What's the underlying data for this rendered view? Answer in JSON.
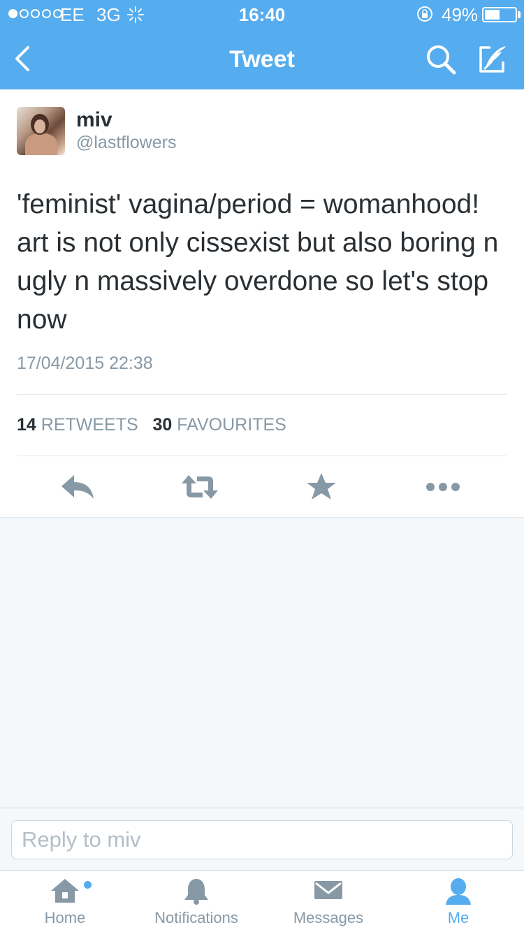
{
  "status_bar": {
    "carrier": "EE",
    "network": "3G",
    "time": "16:40",
    "battery_percent": "49%",
    "battery_level": 0.49,
    "signal_bars_filled": 1,
    "signal_bars_total": 5
  },
  "nav": {
    "title": "Tweet",
    "back_icon": "chevron-left-icon",
    "search_icon": "search-icon",
    "compose_icon": "compose-icon"
  },
  "tweet": {
    "display_name": "miv",
    "handle": "@lastflowers",
    "text": "'feminist' vagina/period = womanhood! art is not only cissexist but also boring n ugly n massively overdone so let's stop now",
    "timestamp": "17/04/2015 22:38",
    "retweets_count": "14",
    "retweets_label": "RETWEETS",
    "favourites_count": "30",
    "favourites_label": "FAVOURITES",
    "actions": [
      "reply-icon",
      "retweet-icon",
      "favourite-icon",
      "more-icon"
    ]
  },
  "reply": {
    "placeholder": "Reply to miv"
  },
  "tab_bar": {
    "items": [
      {
        "label": "Home",
        "icon": "home-icon"
      },
      {
        "label": "Notifications",
        "icon": "bell-icon"
      },
      {
        "label": "Messages",
        "icon": "envelope-icon"
      },
      {
        "label": "Me",
        "icon": "person-icon"
      }
    ],
    "active_index": 3
  },
  "colors": {
    "brand_blue": "#55acee",
    "text_dark": "#292f33",
    "text_muted": "#8899a6",
    "action_gray": "#8899a6"
  }
}
